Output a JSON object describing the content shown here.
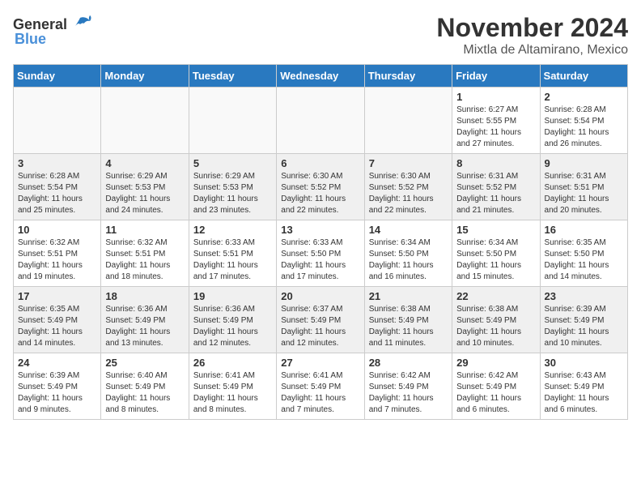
{
  "header": {
    "logo_general": "General",
    "logo_blue": "Blue",
    "month_year": "November 2024",
    "location": "Mixtla de Altamirano, Mexico"
  },
  "weekdays": [
    "Sunday",
    "Monday",
    "Tuesday",
    "Wednesday",
    "Thursday",
    "Friday",
    "Saturday"
  ],
  "weeks": [
    [
      {
        "day": "",
        "info": ""
      },
      {
        "day": "",
        "info": ""
      },
      {
        "day": "",
        "info": ""
      },
      {
        "day": "",
        "info": ""
      },
      {
        "day": "",
        "info": ""
      },
      {
        "day": "1",
        "info": "Sunrise: 6:27 AM\nSunset: 5:55 PM\nDaylight: 11 hours and 27 minutes."
      },
      {
        "day": "2",
        "info": "Sunrise: 6:28 AM\nSunset: 5:54 PM\nDaylight: 11 hours and 26 minutes."
      }
    ],
    [
      {
        "day": "3",
        "info": "Sunrise: 6:28 AM\nSunset: 5:54 PM\nDaylight: 11 hours and 25 minutes."
      },
      {
        "day": "4",
        "info": "Sunrise: 6:29 AM\nSunset: 5:53 PM\nDaylight: 11 hours and 24 minutes."
      },
      {
        "day": "5",
        "info": "Sunrise: 6:29 AM\nSunset: 5:53 PM\nDaylight: 11 hours and 23 minutes."
      },
      {
        "day": "6",
        "info": "Sunrise: 6:30 AM\nSunset: 5:52 PM\nDaylight: 11 hours and 22 minutes."
      },
      {
        "day": "7",
        "info": "Sunrise: 6:30 AM\nSunset: 5:52 PM\nDaylight: 11 hours and 22 minutes."
      },
      {
        "day": "8",
        "info": "Sunrise: 6:31 AM\nSunset: 5:52 PM\nDaylight: 11 hours and 21 minutes."
      },
      {
        "day": "9",
        "info": "Sunrise: 6:31 AM\nSunset: 5:51 PM\nDaylight: 11 hours and 20 minutes."
      }
    ],
    [
      {
        "day": "10",
        "info": "Sunrise: 6:32 AM\nSunset: 5:51 PM\nDaylight: 11 hours and 19 minutes."
      },
      {
        "day": "11",
        "info": "Sunrise: 6:32 AM\nSunset: 5:51 PM\nDaylight: 11 hours and 18 minutes."
      },
      {
        "day": "12",
        "info": "Sunrise: 6:33 AM\nSunset: 5:51 PM\nDaylight: 11 hours and 17 minutes."
      },
      {
        "day": "13",
        "info": "Sunrise: 6:33 AM\nSunset: 5:50 PM\nDaylight: 11 hours and 17 minutes."
      },
      {
        "day": "14",
        "info": "Sunrise: 6:34 AM\nSunset: 5:50 PM\nDaylight: 11 hours and 16 minutes."
      },
      {
        "day": "15",
        "info": "Sunrise: 6:34 AM\nSunset: 5:50 PM\nDaylight: 11 hours and 15 minutes."
      },
      {
        "day": "16",
        "info": "Sunrise: 6:35 AM\nSunset: 5:50 PM\nDaylight: 11 hours and 14 minutes."
      }
    ],
    [
      {
        "day": "17",
        "info": "Sunrise: 6:35 AM\nSunset: 5:49 PM\nDaylight: 11 hours and 14 minutes."
      },
      {
        "day": "18",
        "info": "Sunrise: 6:36 AM\nSunset: 5:49 PM\nDaylight: 11 hours and 13 minutes."
      },
      {
        "day": "19",
        "info": "Sunrise: 6:36 AM\nSunset: 5:49 PM\nDaylight: 11 hours and 12 minutes."
      },
      {
        "day": "20",
        "info": "Sunrise: 6:37 AM\nSunset: 5:49 PM\nDaylight: 11 hours and 12 minutes."
      },
      {
        "day": "21",
        "info": "Sunrise: 6:38 AM\nSunset: 5:49 PM\nDaylight: 11 hours and 11 minutes."
      },
      {
        "day": "22",
        "info": "Sunrise: 6:38 AM\nSunset: 5:49 PM\nDaylight: 11 hours and 10 minutes."
      },
      {
        "day": "23",
        "info": "Sunrise: 6:39 AM\nSunset: 5:49 PM\nDaylight: 11 hours and 10 minutes."
      }
    ],
    [
      {
        "day": "24",
        "info": "Sunrise: 6:39 AM\nSunset: 5:49 PM\nDaylight: 11 hours and 9 minutes."
      },
      {
        "day": "25",
        "info": "Sunrise: 6:40 AM\nSunset: 5:49 PM\nDaylight: 11 hours and 8 minutes."
      },
      {
        "day": "26",
        "info": "Sunrise: 6:41 AM\nSunset: 5:49 PM\nDaylight: 11 hours and 8 minutes."
      },
      {
        "day": "27",
        "info": "Sunrise: 6:41 AM\nSunset: 5:49 PM\nDaylight: 11 hours and 7 minutes."
      },
      {
        "day": "28",
        "info": "Sunrise: 6:42 AM\nSunset: 5:49 PM\nDaylight: 11 hours and 7 minutes."
      },
      {
        "day": "29",
        "info": "Sunrise: 6:42 AM\nSunset: 5:49 PM\nDaylight: 11 hours and 6 minutes."
      },
      {
        "day": "30",
        "info": "Sunrise: 6:43 AM\nSunset: 5:49 PM\nDaylight: 11 hours and 6 minutes."
      }
    ]
  ]
}
